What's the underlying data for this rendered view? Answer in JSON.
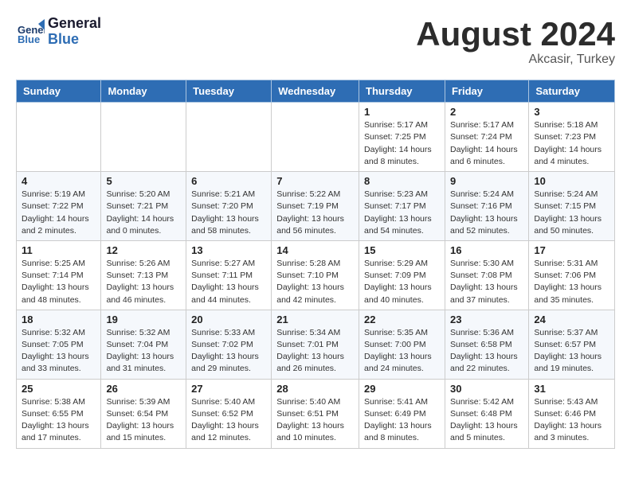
{
  "logo": {
    "line1": "General",
    "line2": "Blue"
  },
  "header": {
    "month": "August 2024",
    "location": "Akcasir, Turkey"
  },
  "days_of_week": [
    "Sunday",
    "Monday",
    "Tuesday",
    "Wednesday",
    "Thursday",
    "Friday",
    "Saturday"
  ],
  "weeks": [
    [
      {
        "day": "",
        "info": ""
      },
      {
        "day": "",
        "info": ""
      },
      {
        "day": "",
        "info": ""
      },
      {
        "day": "",
        "info": ""
      },
      {
        "day": "1",
        "info": "Sunrise: 5:17 AM\nSunset: 7:25 PM\nDaylight: 14 hours\nand 8 minutes."
      },
      {
        "day": "2",
        "info": "Sunrise: 5:17 AM\nSunset: 7:24 PM\nDaylight: 14 hours\nand 6 minutes."
      },
      {
        "day": "3",
        "info": "Sunrise: 5:18 AM\nSunset: 7:23 PM\nDaylight: 14 hours\nand 4 minutes."
      }
    ],
    [
      {
        "day": "4",
        "info": "Sunrise: 5:19 AM\nSunset: 7:22 PM\nDaylight: 14 hours\nand 2 minutes."
      },
      {
        "day": "5",
        "info": "Sunrise: 5:20 AM\nSunset: 7:21 PM\nDaylight: 14 hours\nand 0 minutes."
      },
      {
        "day": "6",
        "info": "Sunrise: 5:21 AM\nSunset: 7:20 PM\nDaylight: 13 hours\nand 58 minutes."
      },
      {
        "day": "7",
        "info": "Sunrise: 5:22 AM\nSunset: 7:19 PM\nDaylight: 13 hours\nand 56 minutes."
      },
      {
        "day": "8",
        "info": "Sunrise: 5:23 AM\nSunset: 7:17 PM\nDaylight: 13 hours\nand 54 minutes."
      },
      {
        "day": "9",
        "info": "Sunrise: 5:24 AM\nSunset: 7:16 PM\nDaylight: 13 hours\nand 52 minutes."
      },
      {
        "day": "10",
        "info": "Sunrise: 5:24 AM\nSunset: 7:15 PM\nDaylight: 13 hours\nand 50 minutes."
      }
    ],
    [
      {
        "day": "11",
        "info": "Sunrise: 5:25 AM\nSunset: 7:14 PM\nDaylight: 13 hours\nand 48 minutes."
      },
      {
        "day": "12",
        "info": "Sunrise: 5:26 AM\nSunset: 7:13 PM\nDaylight: 13 hours\nand 46 minutes."
      },
      {
        "day": "13",
        "info": "Sunrise: 5:27 AM\nSunset: 7:11 PM\nDaylight: 13 hours\nand 44 minutes."
      },
      {
        "day": "14",
        "info": "Sunrise: 5:28 AM\nSunset: 7:10 PM\nDaylight: 13 hours\nand 42 minutes."
      },
      {
        "day": "15",
        "info": "Sunrise: 5:29 AM\nSunset: 7:09 PM\nDaylight: 13 hours\nand 40 minutes."
      },
      {
        "day": "16",
        "info": "Sunrise: 5:30 AM\nSunset: 7:08 PM\nDaylight: 13 hours\nand 37 minutes."
      },
      {
        "day": "17",
        "info": "Sunrise: 5:31 AM\nSunset: 7:06 PM\nDaylight: 13 hours\nand 35 minutes."
      }
    ],
    [
      {
        "day": "18",
        "info": "Sunrise: 5:32 AM\nSunset: 7:05 PM\nDaylight: 13 hours\nand 33 minutes."
      },
      {
        "day": "19",
        "info": "Sunrise: 5:32 AM\nSunset: 7:04 PM\nDaylight: 13 hours\nand 31 minutes."
      },
      {
        "day": "20",
        "info": "Sunrise: 5:33 AM\nSunset: 7:02 PM\nDaylight: 13 hours\nand 29 minutes."
      },
      {
        "day": "21",
        "info": "Sunrise: 5:34 AM\nSunset: 7:01 PM\nDaylight: 13 hours\nand 26 minutes."
      },
      {
        "day": "22",
        "info": "Sunrise: 5:35 AM\nSunset: 7:00 PM\nDaylight: 13 hours\nand 24 minutes."
      },
      {
        "day": "23",
        "info": "Sunrise: 5:36 AM\nSunset: 6:58 PM\nDaylight: 13 hours\nand 22 minutes."
      },
      {
        "day": "24",
        "info": "Sunrise: 5:37 AM\nSunset: 6:57 PM\nDaylight: 13 hours\nand 19 minutes."
      }
    ],
    [
      {
        "day": "25",
        "info": "Sunrise: 5:38 AM\nSunset: 6:55 PM\nDaylight: 13 hours\nand 17 minutes."
      },
      {
        "day": "26",
        "info": "Sunrise: 5:39 AM\nSunset: 6:54 PM\nDaylight: 13 hours\nand 15 minutes."
      },
      {
        "day": "27",
        "info": "Sunrise: 5:40 AM\nSunset: 6:52 PM\nDaylight: 13 hours\nand 12 minutes."
      },
      {
        "day": "28",
        "info": "Sunrise: 5:40 AM\nSunset: 6:51 PM\nDaylight: 13 hours\nand 10 minutes."
      },
      {
        "day": "29",
        "info": "Sunrise: 5:41 AM\nSunset: 6:49 PM\nDaylight: 13 hours\nand 8 minutes."
      },
      {
        "day": "30",
        "info": "Sunrise: 5:42 AM\nSunset: 6:48 PM\nDaylight: 13 hours\nand 5 minutes."
      },
      {
        "day": "31",
        "info": "Sunrise: 5:43 AM\nSunset: 6:46 PM\nDaylight: 13 hours\nand 3 minutes."
      }
    ]
  ]
}
